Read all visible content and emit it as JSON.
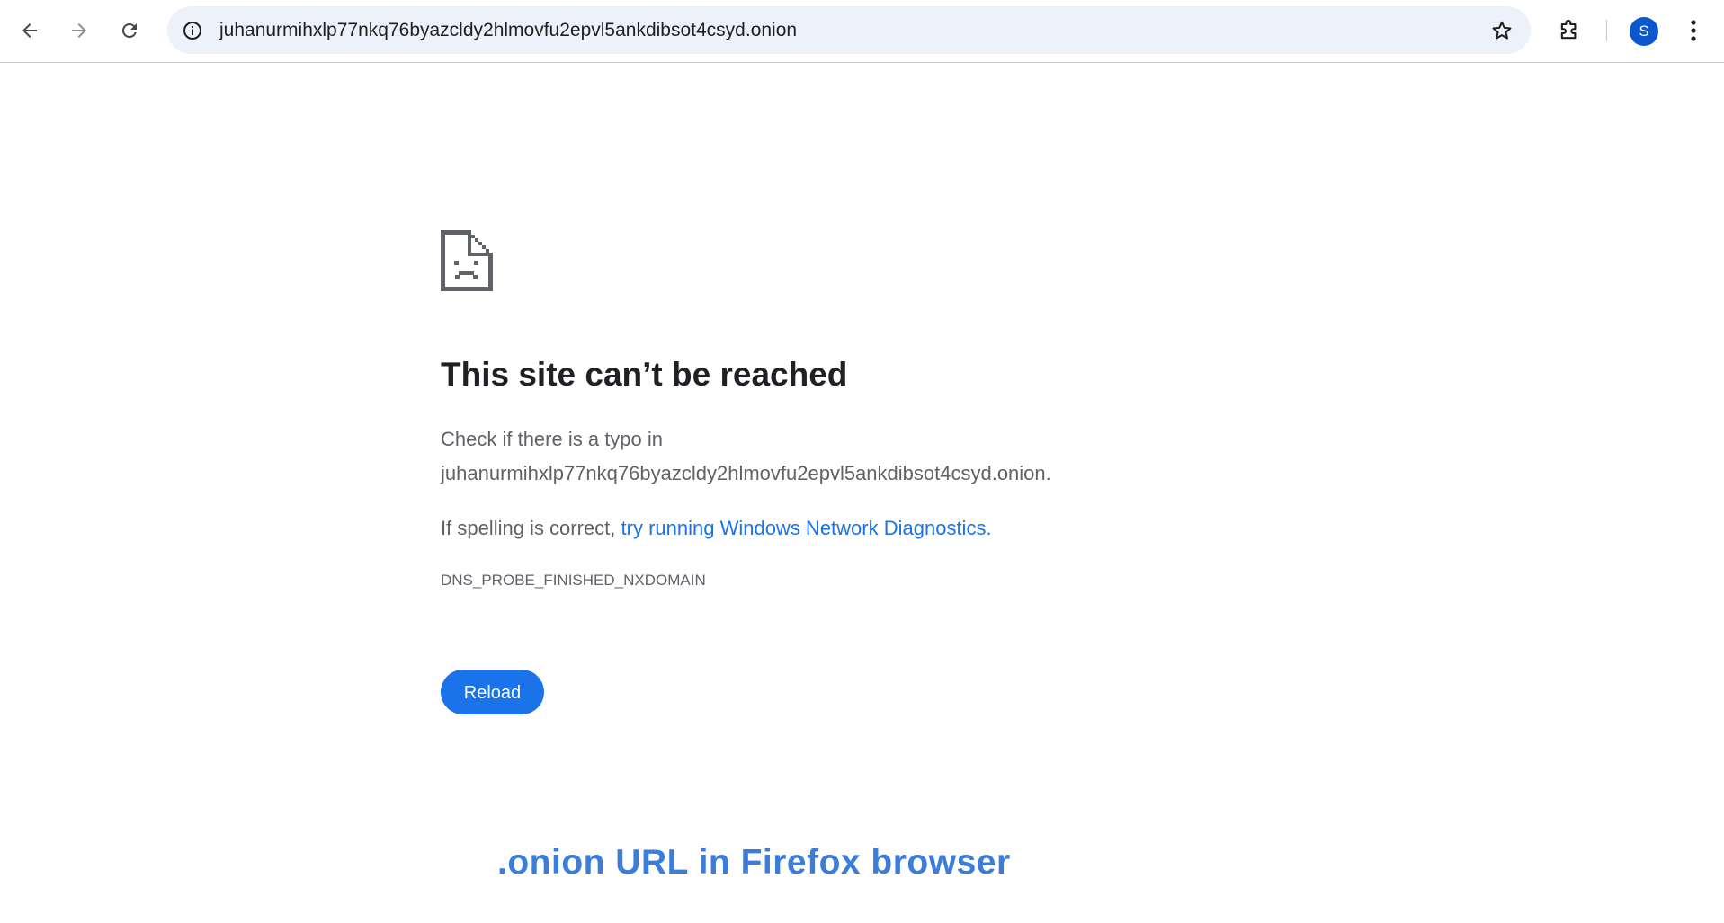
{
  "browser": {
    "address_bar": {
      "url": "juhanurmihxlp77nkq76byazcldy2hlmovfu2epvl5ankdibsot4csyd.onion"
    },
    "icons": {
      "back": "arrow-left-icon",
      "forward": "arrow-right-icon",
      "reload": "reload-icon",
      "site_info": "info-icon",
      "bookmark": "star-icon",
      "extensions": "puzzle-icon",
      "menu": "three-dot-menu-icon"
    },
    "profile": {
      "avatar_letter": "S",
      "avatar_color": "#0b57d0"
    }
  },
  "error_page": {
    "icon": "sad-page-icon",
    "title": "This site can’t be reached",
    "typo_check_prefix": "Check if there is a typo in",
    "typo_check_host": "juhanurmihxlp77nkq76byazcldy2hlmovfu2epvl5ankdibsot4csyd.onion.",
    "spelling_prefix": "If spelling is correct, ",
    "diagnostics_link": "try running Windows Network Diagnostics",
    "spelling_suffix": ".",
    "error_code": "DNS_PROBE_FINISHED_NXDOMAIN",
    "reload_label": "Reload"
  },
  "caption": {
    "text": ".onion URL in Firefox browser",
    "color": "#3b7dd8"
  },
  "colors": {
    "accent": "#1a73e8",
    "body_text": "#5f6368",
    "title_text": "#202124"
  }
}
